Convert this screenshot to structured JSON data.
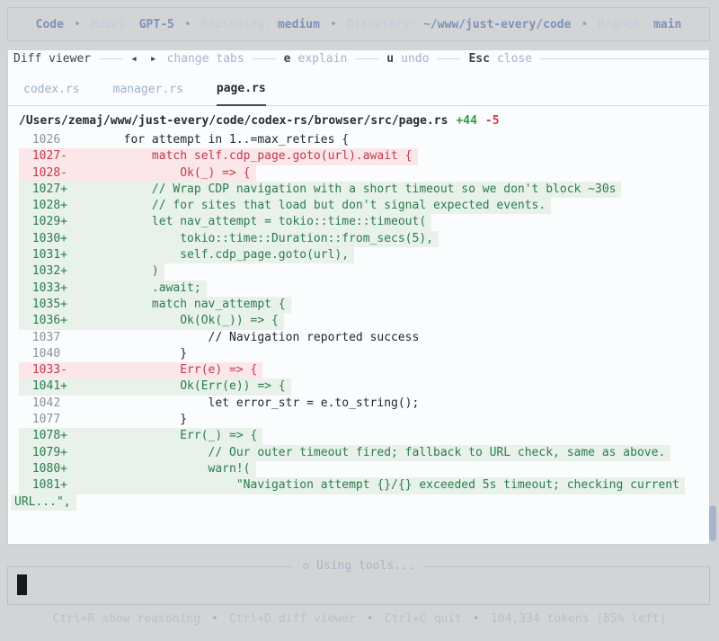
{
  "topbar": {
    "app": "Code",
    "separator": "•",
    "items": [
      {
        "label": "Model:",
        "value": "GPT-5"
      },
      {
        "label": "Reasoning:",
        "value": "medium"
      },
      {
        "label": "Directory:",
        "value": "~/www/just-every/code"
      },
      {
        "label": "Branch:",
        "value": "main"
      }
    ]
  },
  "diff_viewer": {
    "title": "Diff viewer",
    "hints": [
      {
        "keys": "◂ ▸",
        "label": "change tabs"
      },
      {
        "keys": "e",
        "label": "explain"
      },
      {
        "keys": "u",
        "label": "undo"
      },
      {
        "keys": "Esc",
        "label": "close"
      }
    ],
    "tabs": {
      "active_index": 2,
      "items": [
        "codex.rs",
        "manager.rs",
        "page.rs"
      ]
    },
    "file": {
      "path": "/Users/zemaj/www/just-every/code/codex-rs/browser/src/page.rs",
      "additions": "+44",
      "deletions": "-5"
    },
    "lines": [
      {
        "num": "1026",
        "sign": " ",
        "type": "ctx",
        "code": "        for attempt in 1..=max_retries {"
      },
      {
        "num": "1027",
        "sign": "-",
        "type": "del",
        "code": "            match self.cdp_page.goto(url).await {"
      },
      {
        "num": "1028",
        "sign": "-",
        "type": "del",
        "code": "                Ok(_) => {"
      },
      {
        "num": "1027",
        "sign": "+",
        "type": "add",
        "code": "            // Wrap CDP navigation with a short timeout so we don't block ~30s"
      },
      {
        "num": "1028",
        "sign": "+",
        "type": "add",
        "code": "            // for sites that load but don't signal expected events."
      },
      {
        "num": "1029",
        "sign": "+",
        "type": "add",
        "code": "            let nav_attempt = tokio::time::timeout("
      },
      {
        "num": "1030",
        "sign": "+",
        "type": "add",
        "code": "                tokio::time::Duration::from_secs(5),"
      },
      {
        "num": "1031",
        "sign": "+",
        "type": "add",
        "code": "                self.cdp_page.goto(url),"
      },
      {
        "num": "1032",
        "sign": "+",
        "type": "add",
        "code": "            )"
      },
      {
        "num": "1033",
        "sign": "+",
        "type": "add",
        "code": "            .await;"
      },
      {
        "num": "1035",
        "sign": "+",
        "type": "add",
        "code": "            match nav_attempt {"
      },
      {
        "num": "1036",
        "sign": "+",
        "type": "add",
        "code": "                Ok(Ok(_)) => {"
      },
      {
        "num": "1037",
        "sign": " ",
        "type": "ctx",
        "code": "                    // Navigation reported success"
      },
      {
        "num": "1040",
        "sign": " ",
        "type": "ctx",
        "code": "                }"
      },
      {
        "num": "1033",
        "sign": "-",
        "type": "del",
        "code": "                Err(e) => {"
      },
      {
        "num": "1041",
        "sign": "+",
        "type": "add",
        "code": "                Ok(Err(e)) => {"
      },
      {
        "num": "1042",
        "sign": " ",
        "type": "ctx",
        "code": "                    let error_str = e.to_string();"
      },
      {
        "num": "1077",
        "sign": " ",
        "type": "ctx",
        "code": "                }"
      },
      {
        "num": "1078",
        "sign": "+",
        "type": "add",
        "code": "                Err(_) => {"
      },
      {
        "num": "1079",
        "sign": "+",
        "type": "add",
        "code": "                    // Our outer timeout fired; fallback to URL check, same as above."
      },
      {
        "num": "1080",
        "sign": "+",
        "type": "add",
        "code": "                    warn!("
      },
      {
        "num": "1081",
        "sign": "+",
        "type": "add",
        "code": "                        \"Navigation attempt {}/{} exceeded 5s timeout; checking current"
      },
      {
        "wrap": true,
        "type": "add",
        "code": "URL...\","
      }
    ]
  },
  "composer": {
    "icon": "◇",
    "status_label": "Using tools..."
  },
  "statusbar": {
    "separator": "•",
    "shortcuts": [
      {
        "key": "Ctrl+R",
        "label": "show reasoning"
      },
      {
        "key": "Ctrl+D",
        "label": "diff viewer"
      },
      {
        "key": "Ctrl+C",
        "label": "quit"
      }
    ],
    "tokens": "104,334 tokens (85% left)"
  },
  "colors": {
    "page_bg": "#d3d4d6",
    "panel_bg": "#fbfcfd",
    "accent_blue": "#7d92ba",
    "muted_blue": "#a9b4c8",
    "added_text": "#2c7c4e",
    "added_bg": "#e8f1ea",
    "removed_text": "#c03a4b",
    "removed_bg": "#fbe7e9",
    "tab_active": "#272c31",
    "cursor": "#17191c"
  }
}
